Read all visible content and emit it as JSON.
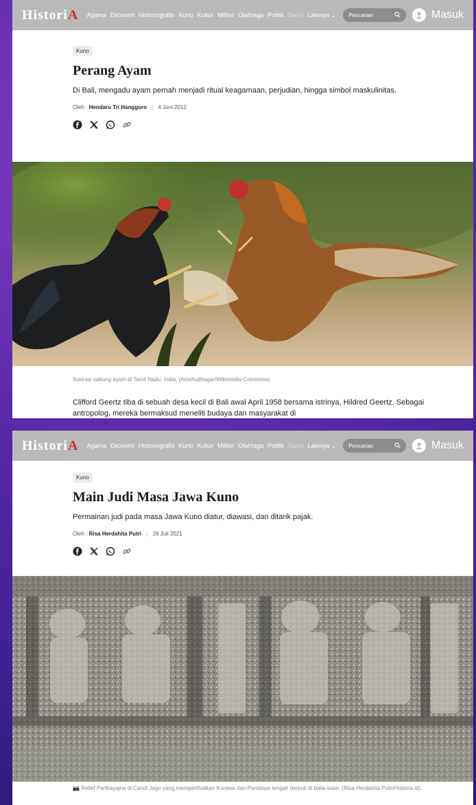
{
  "nav": {
    "logo_prefix": "HistoriA",
    "links": [
      "Agama",
      "Ekonomi",
      "Historiografis",
      "Kuno",
      "Kultur",
      "Militer",
      "Olahraga",
      "Politik"
    ],
    "faded_link": "Sains",
    "more_label": "Lainnya",
    "search_placeholder": "Pencarian",
    "login_label": "Masuk"
  },
  "articles": [
    {
      "category": "Kuno",
      "title": "Perang Ayam",
      "lead": "Di Bali, mengadu ayam pernah menjadi ritual keagamaan, perjudian, hingga simbol maskulinitas.",
      "byline_prefix": "Oleh :",
      "author": "Hendaru Tri Hanggoro",
      "date": "4 Juni 2012",
      "caption": "Ilustrasi sabung ayam di Tamil Nadu, India. (Amshudhagar/Wikimedia Commons).",
      "body": "Clifford Geertz tiba di sebuah desa kecil di Bali awal April 1958 bersama istrinya, Hildred Geertz. Sebagai antropolog, mereka bermaksud meneliti budaya dan masyarakat di"
    },
    {
      "category": "Kuno",
      "title": "Main Judi Masa Jawa Kuno",
      "lead": "Permainan judi pada masa Jawa Kuno diatur, diawasi, dan ditarik pajak.",
      "byline_prefix": "Oleh :",
      "author": "Risa Herdahita Putri",
      "date": "28 Juli 2021",
      "caption": "Relief Parthayajna di Candi Jago yang memperlihatkan Kurawa dan Pandawa tengah berjudi di balai-balai. (Risa Herdahita Putri/Historia.id).",
      "body": ""
    }
  ],
  "colors": {
    "nav_bg": "#b9b9b9",
    "logo_accent": "#c72e2e",
    "page_bg": "#ffffff"
  },
  "icons": [
    "facebook-icon",
    "x-icon",
    "whatsapp-icon",
    "link-icon",
    "search-icon",
    "user-icon",
    "chevron-down-icon",
    "camera-icon"
  ]
}
